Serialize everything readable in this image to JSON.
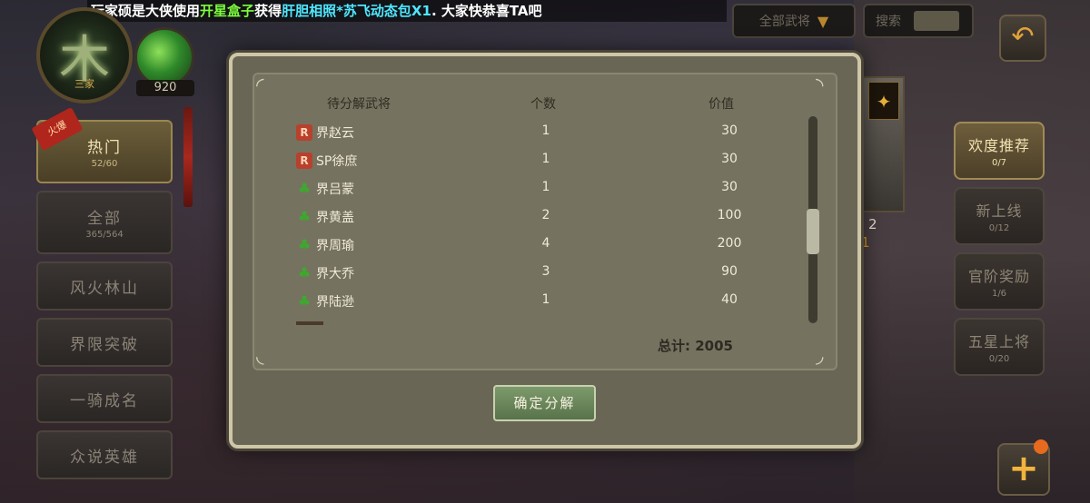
{
  "marquee": {
    "p1": "玩家",
    "player": "硕是大侠",
    "p2": "使用",
    "item": "开星盒子",
    "p3": "获得",
    "reward": "肝胆相照*苏飞动态包X1",
    "p4": ". 大家快恭喜TA吧"
  },
  "emblem": {
    "glyph": "木",
    "caption": "三家",
    "jade_count": "920"
  },
  "sidebar": {
    "items": [
      {
        "label": "热门",
        "sub": "52/60",
        "tag": "火爆"
      },
      {
        "label": "全部",
        "sub": "365/564"
      },
      {
        "label": "风火林山"
      },
      {
        "label": "界限突破"
      },
      {
        "label": "一骑成名"
      },
      {
        "label": "众说英雄"
      }
    ]
  },
  "top": {
    "dropdown_label": "全部武将",
    "search_label": "搜索"
  },
  "right_menu": {
    "items": [
      {
        "label": "欢度推荐",
        "sub": "0/7"
      },
      {
        "label": "新上线",
        "sub": "0/12"
      },
      {
        "label": "官阶奖励",
        "sub": "1/6"
      },
      {
        "label": "五星上将",
        "sub": "0/20"
      }
    ]
  },
  "character": {
    "count": "2",
    "stars": "1"
  },
  "dialog": {
    "headers": {
      "name": "待分解武将",
      "count": "个数",
      "value": "价值"
    },
    "rows": [
      {
        "rarity": "red",
        "name": "界赵云",
        "count": "1",
        "value": "30"
      },
      {
        "rarity": "red",
        "name": "SP徐庶",
        "count": "1",
        "value": "30"
      },
      {
        "rarity": "green",
        "name": "界吕蒙",
        "count": "1",
        "value": "30"
      },
      {
        "rarity": "green",
        "name": "界黄盖",
        "count": "2",
        "value": "100"
      },
      {
        "rarity": "green",
        "name": "界周瑜",
        "count": "4",
        "value": "200"
      },
      {
        "rarity": "green",
        "name": "界大乔",
        "count": "3",
        "value": "90"
      },
      {
        "rarity": "green",
        "name": "界陆逊",
        "count": "1",
        "value": "40"
      }
    ],
    "total": "总计: 2005",
    "confirm": "确定分解"
  },
  "colors": {
    "accent_green": "#7dff3c",
    "accent_cyan": "#4fe8ff",
    "rarity_red": "#b8402c",
    "rarity_green": "#3ea82e"
  }
}
